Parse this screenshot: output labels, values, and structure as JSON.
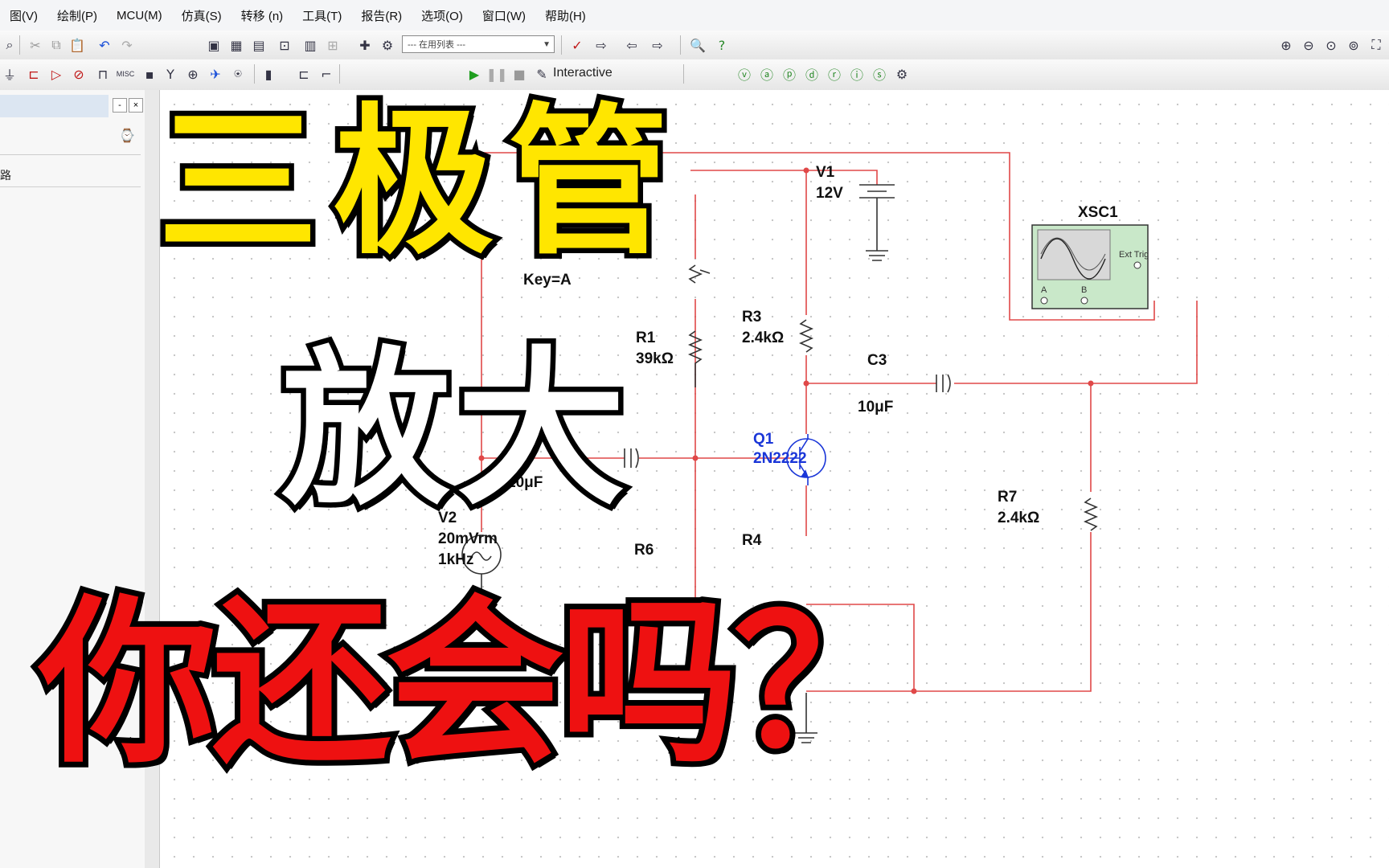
{
  "menu": [
    "图(V)",
    "绘制(P)",
    "MCU(M)",
    "仿真(S)",
    "转移 (n)",
    "工具(T)",
    "报告(R)",
    "选项(O)",
    "窗口(W)",
    "帮助(H)"
  ],
  "toolbar": {
    "in_use_list": "--- 在用列表 ---",
    "sim_mode": "Interactive",
    "misc_label": "MISC"
  },
  "left_panel": {
    "tree_item": "路",
    "ctrl_minimize": "-",
    "ctrl_close": "×"
  },
  "title": {
    "line1": "三极管",
    "line2": "放大",
    "line3": "你还会吗？"
  },
  "schematic": {
    "key_label": "Key=A",
    "v1": {
      "name": "V1",
      "value": "12V"
    },
    "r1": {
      "name": "R1",
      "value": "39kΩ"
    },
    "r3": {
      "name": "R3",
      "value": "2.4kΩ"
    },
    "c3": {
      "name": "C3",
      "value": "10μF"
    },
    "cin": {
      "value": "10μF"
    },
    "q1": {
      "name": "Q1",
      "model": "2N2222"
    },
    "r7": {
      "name": "R7",
      "value": "2.4kΩ"
    },
    "v2": {
      "name": "V2",
      "value": "20mVrm",
      "freq": "1kHz"
    },
    "r4": {
      "name": "R4"
    },
    "r6": {
      "name": "R6"
    },
    "xsc1": {
      "name": "XSC1",
      "ext_trig": "Ext Trig",
      "ch_a": "A",
      "ch_b": "B"
    }
  },
  "colors": {
    "wire": "#e04848",
    "title_yellow": "#ffe600",
    "title_red": "#ee1111",
    "transistor_label": "#1a36d8"
  }
}
